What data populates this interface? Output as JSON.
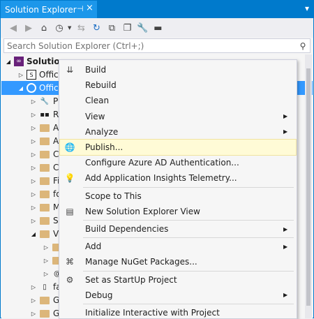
{
  "window": {
    "title": "Solution Explorer",
    "pin_glyph": "⊣",
    "close_glyph": "×",
    "menu_glyph": "▾"
  },
  "search": {
    "placeholder": "Search Solution Explorer (Ctrl+;)"
  },
  "tree": {
    "rows": [
      {
        "label": "Solution",
        "indent": 0
      },
      {
        "label": "Offic",
        "indent": 1
      },
      {
        "label": "Offic",
        "indent": 1,
        "selected": true
      },
      {
        "label": "P",
        "indent": 2
      },
      {
        "label": "Re",
        "indent": 2
      },
      {
        "label": "A",
        "indent": 2
      },
      {
        "label": "A",
        "indent": 2
      },
      {
        "label": "C",
        "indent": 2
      },
      {
        "label": "C",
        "indent": 2
      },
      {
        "label": "Fi",
        "indent": 2
      },
      {
        "label": "fo",
        "indent": 2
      },
      {
        "label": "M",
        "indent": 2
      },
      {
        "label": "Sc",
        "indent": 2
      },
      {
        "label": "Vi",
        "indent": 2
      },
      {
        "label": "",
        "indent": 3
      },
      {
        "label": "",
        "indent": 3
      },
      {
        "label": "",
        "indent": 3
      },
      {
        "label": "fa",
        "indent": 2
      },
      {
        "label": "G",
        "indent": 2
      },
      {
        "label": "Gl",
        "indent": 2
      }
    ]
  },
  "context_menu": {
    "items": [
      {
        "label": "Build",
        "icon": "build-icon",
        "glyph": "⇊"
      },
      {
        "label": "Rebuild"
      },
      {
        "label": "Clean"
      },
      {
        "label": "View",
        "submenu": true
      },
      {
        "label": "Analyze",
        "submenu": true
      },
      {
        "label": "Publish...",
        "icon": "publish-globe-icon",
        "glyph": "🌐",
        "highlighted": true
      },
      {
        "label": "Configure Azure AD Authentication..."
      },
      {
        "label": "Add Application Insights Telemetry...",
        "icon": "app-insights-icon",
        "glyph": "💡"
      },
      {
        "separator": true
      },
      {
        "label": "Scope to This"
      },
      {
        "label": "New Solution Explorer View",
        "icon": "new-view-icon",
        "glyph": "▤"
      },
      {
        "separator": true
      },
      {
        "label": "Build Dependencies",
        "submenu": true
      },
      {
        "separator": true
      },
      {
        "label": "Add",
        "submenu": true
      },
      {
        "label": "Manage NuGet Packages...",
        "icon": "nuget-icon",
        "glyph": "⌘"
      },
      {
        "separator": true
      },
      {
        "label": "Set as StartUp Project",
        "icon": "gear-icon",
        "glyph": "⚙"
      },
      {
        "label": "Debug",
        "submenu": true
      },
      {
        "separator": true
      },
      {
        "label": "Initialize Interactive with Project"
      }
    ]
  },
  "colors": {
    "accent": "#007acc",
    "selection": "#3399ff",
    "menu_highlight": "#fffbd6"
  }
}
